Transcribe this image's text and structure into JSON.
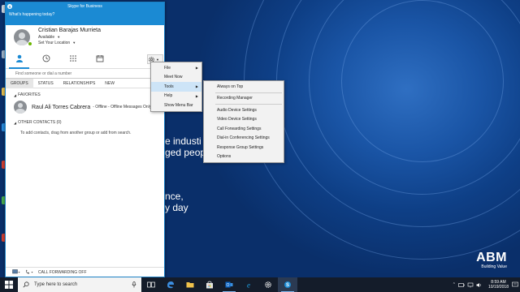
{
  "skype": {
    "window_title": "Skype for Business",
    "mood_prompt": "What's happening today?",
    "user": {
      "name": "Cristian Barajas Murrieta",
      "status": "Available",
      "location": "Set Your Location"
    },
    "search_placeholder": "Find someone or dial a number",
    "tabs": [
      "GROUPS",
      "STATUS",
      "RELATIONSHIPS",
      "NEW"
    ],
    "favorites_label": "FAVORITES",
    "favorite_contact": {
      "name": "Raul Ali Torres Cabrera",
      "note": "- Offline - Offline Messages Only"
    },
    "other_contacts_label": "OTHER CONTACTS (0)",
    "add_contacts_hint": "To add contacts, drag from another group or add from search.",
    "call_forwarding": "CALL FORWARDING OFF"
  },
  "main_menu": [
    {
      "label": "File",
      "has_submenu": true
    },
    {
      "label": "Meet Now",
      "has_submenu": false
    },
    {
      "label": "Tools",
      "has_submenu": true,
      "highlighted": true
    },
    {
      "label": "Help",
      "has_submenu": true
    },
    {
      "label": "Show Menu Bar",
      "has_submenu": false
    }
  ],
  "tools_menu": [
    "Always on Top",
    "Recording Manager",
    "Audio Device Settings",
    "Video Device Settings",
    "Call Forwarding Settings",
    "Dial-in Conferencing Settings",
    "Response Group Settings",
    "Options"
  ],
  "desktop": {
    "text_line1": "e industi",
    "text_line2": "ged peopl",
    "text_line3": "nce,",
    "text_line4": "y day",
    "brand": "ABM",
    "brand_tagline": "Building Value"
  },
  "taskbar": {
    "search_placeholder": "Type here to search",
    "time": "8:59 AM",
    "date": "10/19/2018"
  },
  "colors": {
    "skype_blue": "#1b8ad3",
    "presence_available": "#6bb700",
    "desktop_blue": "#0e3f86"
  }
}
